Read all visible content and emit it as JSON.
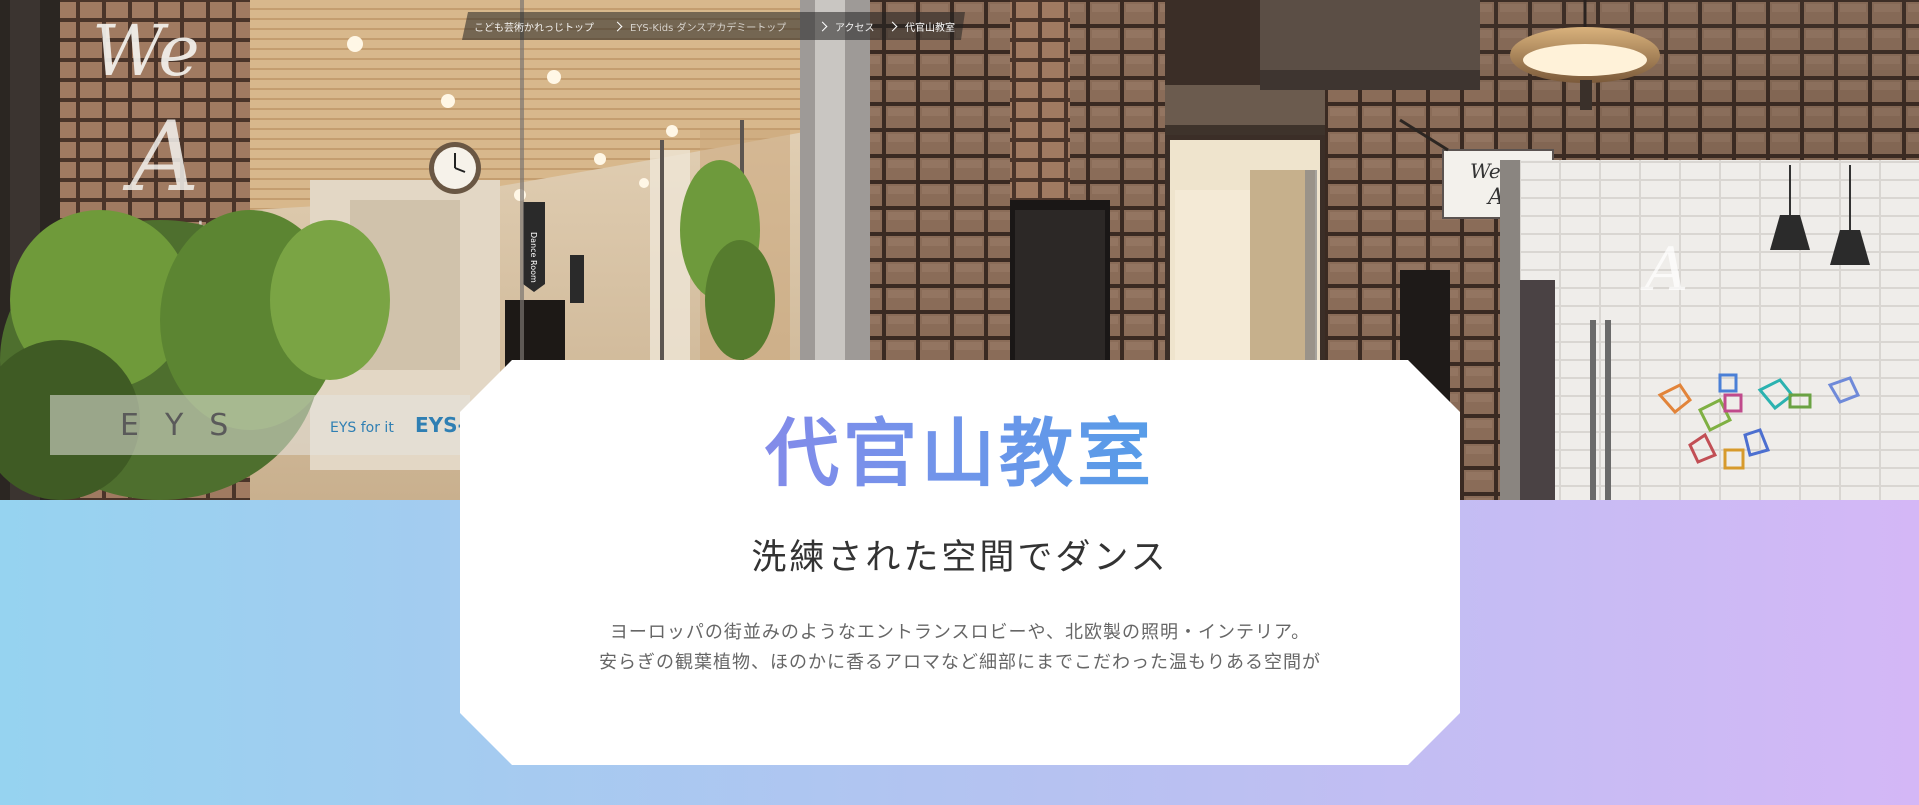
{
  "breadcrumb": {
    "items": [
      {
        "label": "こども芸術かれっじトップ",
        "current": false
      },
      {
        "label": "EYS-Kids ダンスアカデミートップ",
        "current": false
      },
      {
        "label": "アクセス",
        "current": false
      },
      {
        "label": "代官山教室",
        "current": true
      }
    ]
  },
  "hero": {
    "signage": {
      "we_art_logo": "We Art",
      "dance_room_sign": "Dance Room",
      "eys_sign": "EYS",
      "eys_for_it": "EYS for it"
    }
  },
  "card": {
    "title": "代官山教室",
    "subtitle": "洗練された空間でダンス",
    "body_lines": [
      "ヨーロッパの街並みのようなエントランスロビーや、北欧製の照明・インテリア。",
      "安らぎの観葉植物、ほのかに香るアロマなど細部にまでこだわった温もりある空間が"
    ]
  },
  "colors": {
    "title_gradient": [
      "#a27be8",
      "#6f95ea",
      "#2fa7e4"
    ],
    "background_gradient": [
      "#96d3f0",
      "#b6c2f1",
      "#d4b7f6"
    ],
    "breadcrumb_bg": "#232323"
  }
}
